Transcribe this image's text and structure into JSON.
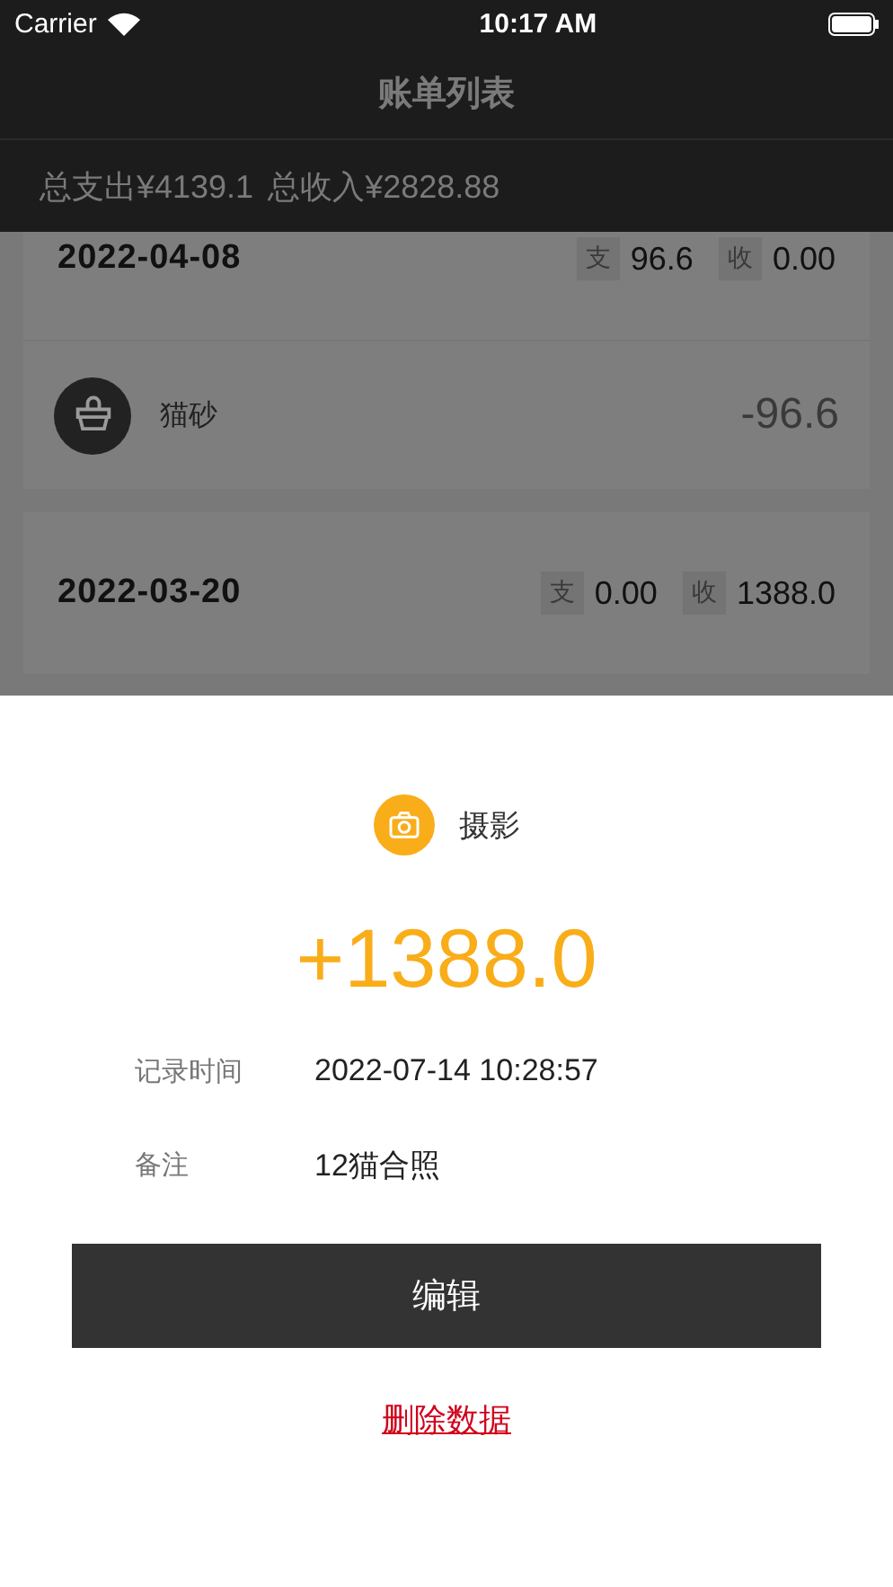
{
  "status_bar": {
    "carrier": "Carrier",
    "time": "10:17 AM"
  },
  "nav": {
    "title": "账单列表"
  },
  "summary": {
    "expense": "总支出¥4139.1",
    "income": "总收入¥2828.88"
  },
  "groups": [
    {
      "date": "2022-04-08",
      "expense_label": "支",
      "expense": "96.6",
      "income_label": "收",
      "income": "0.00",
      "items": [
        {
          "kind": "litter",
          "name": "猫砂",
          "amount": "-96.6"
        }
      ]
    },
    {
      "date": "2022-03-20",
      "expense_label": "支",
      "expense": "0.00",
      "income_label": "收",
      "income": "1388.0"
    }
  ],
  "detail": {
    "kind": "camera",
    "category": "摄影",
    "amount": "+1388.0",
    "fields": [
      {
        "label": "记录时间",
        "value": "2022-07-14 10:28:57"
      },
      {
        "label": "备注",
        "value": "12猫合照"
      }
    ],
    "edit_button": "编辑",
    "delete_link": "删除数据"
  }
}
